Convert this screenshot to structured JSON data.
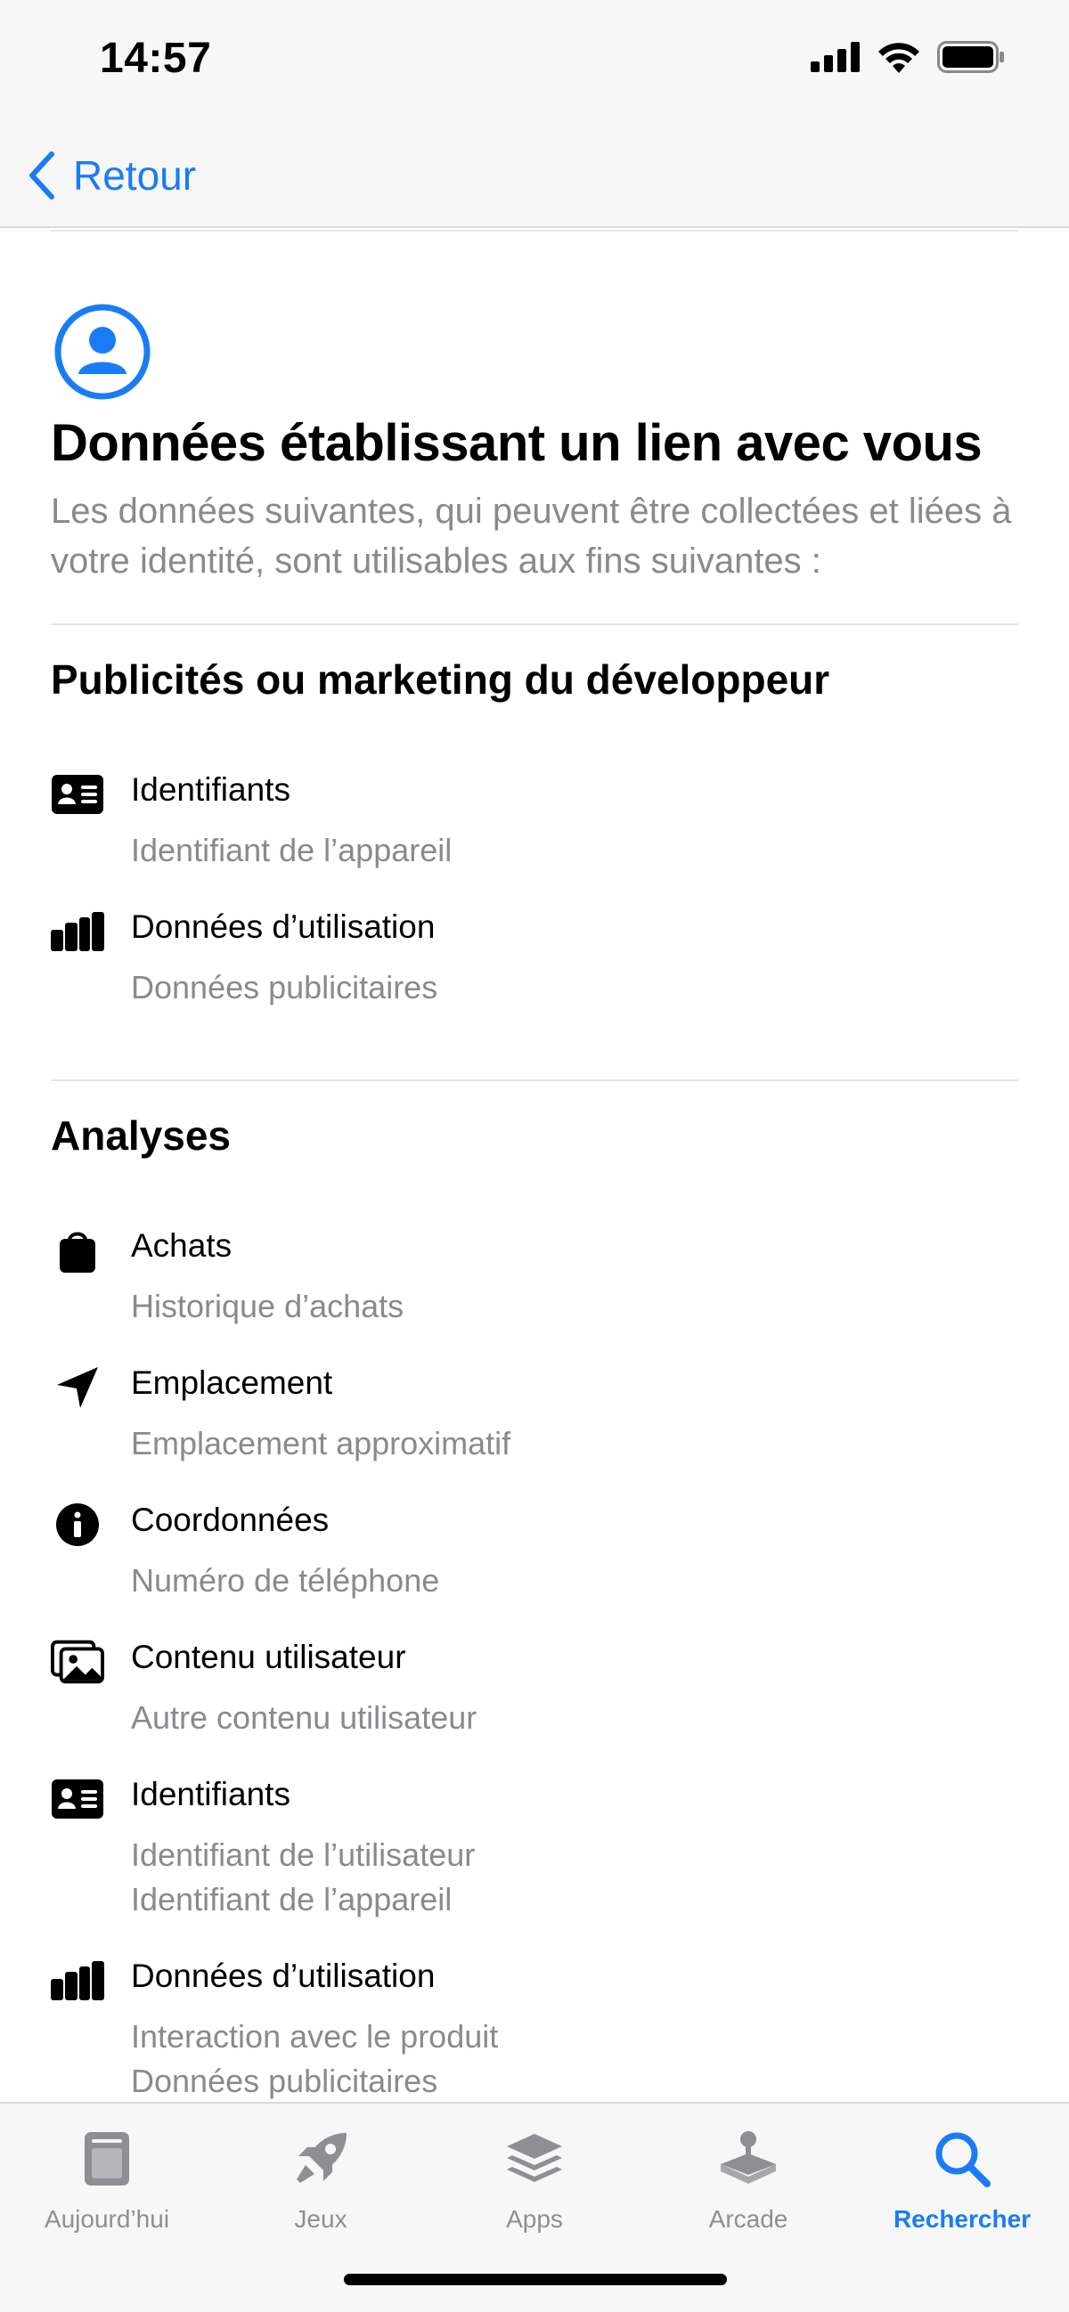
{
  "status_bar": {
    "time": "14:57"
  },
  "nav": {
    "back_label": "Retour"
  },
  "section": {
    "title": "Données établissant un lien avec vous",
    "description": "Les données suivantes, qui peuvent être collectées et liées à votre identité, sont utilisables aux fins suivantes :"
  },
  "groups": [
    {
      "title": "Publicités ou marketing du développeur",
      "items": [
        {
          "icon": "id-card-icon",
          "label": "Identifiants",
          "subs": [
            "Identifiant de l’appareil"
          ]
        },
        {
          "icon": "bar-chart-icon",
          "label": "Données d’utilisation",
          "subs": [
            "Données publicitaires"
          ]
        }
      ]
    },
    {
      "title": "Analyses",
      "items": [
        {
          "icon": "shopping-bag-icon",
          "label": "Achats",
          "subs": [
            "Historique d’achats"
          ]
        },
        {
          "icon": "location-arrow-icon",
          "label": "Emplacement",
          "subs": [
            "Emplacement approximatif"
          ]
        },
        {
          "icon": "info-icon",
          "label": "Coordonnées",
          "subs": [
            "Numéro de téléphone"
          ]
        },
        {
          "icon": "photos-icon",
          "label": "Contenu utilisateur",
          "subs": [
            "Autre contenu utilisateur"
          ]
        },
        {
          "icon": "id-card-icon",
          "label": "Identifiants",
          "subs": [
            "Identifiant de l’utilisateur",
            "Identifiant de l’appareil"
          ]
        },
        {
          "icon": "bar-chart-icon",
          "label": "Données d’utilisation",
          "subs": [
            "Interaction avec le produit",
            "Données publicitaires"
          ]
        }
      ]
    }
  ],
  "tabs": [
    {
      "label": "Aujourd’hui",
      "icon": "today-icon",
      "active": false
    },
    {
      "label": "Jeux",
      "icon": "rocket-icon",
      "active": false
    },
    {
      "label": "Apps",
      "icon": "apps-stack-icon",
      "active": false
    },
    {
      "label": "Arcade",
      "icon": "joystick-icon",
      "active": false
    },
    {
      "label": "Rechercher",
      "icon": "search-icon",
      "active": true
    }
  ],
  "colors": {
    "accent": "#1a7cf5",
    "secondary_text": "#8a8a8e",
    "tab_inactive": "#8e8e93"
  }
}
